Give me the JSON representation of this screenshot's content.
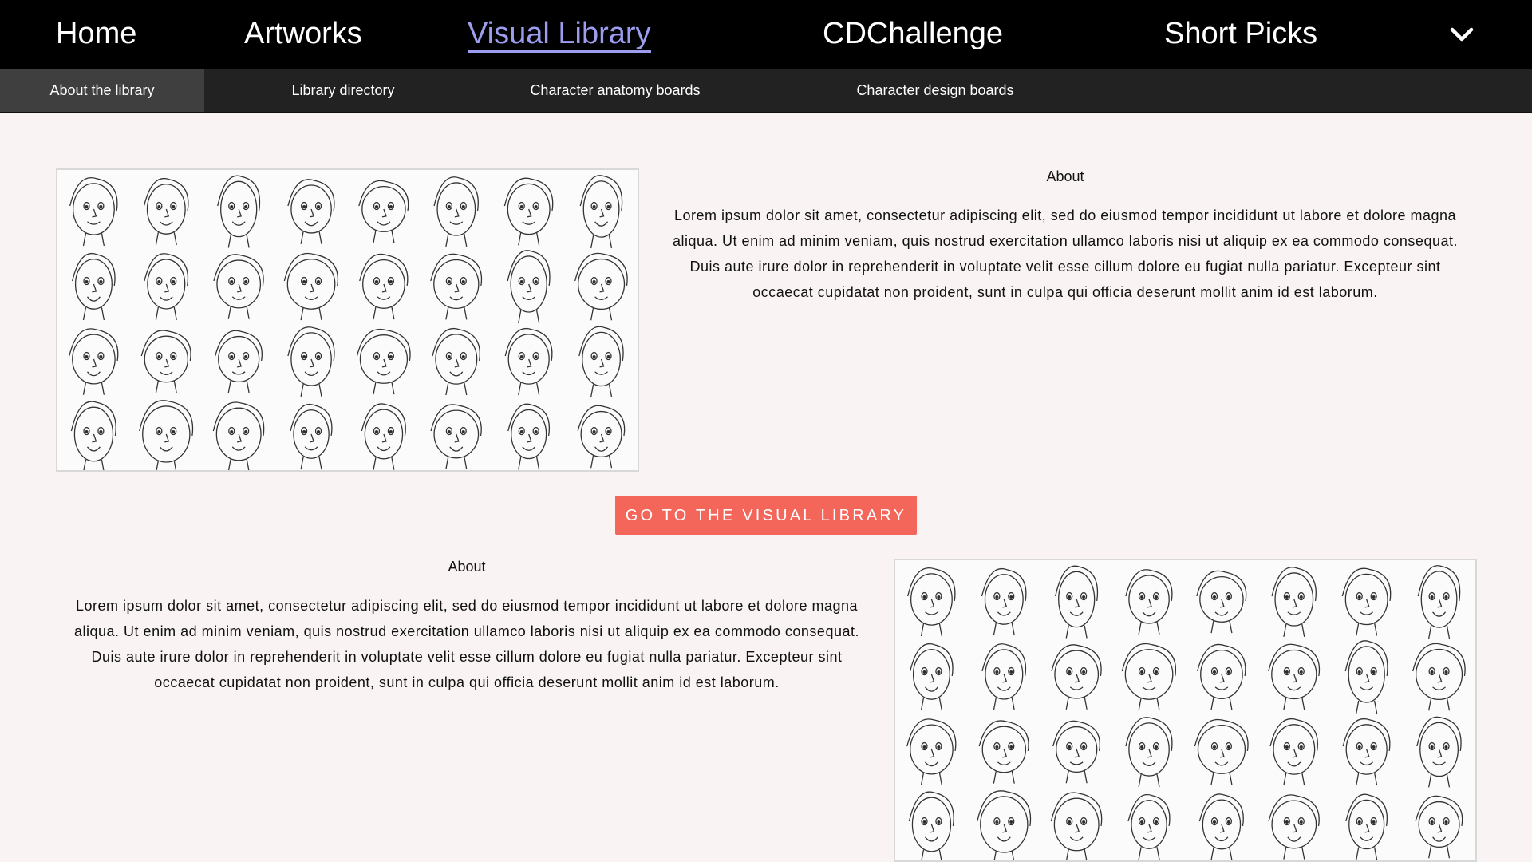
{
  "nav": {
    "items": [
      {
        "label": "Home"
      },
      {
        "label": "Artworks"
      },
      {
        "label": "Visual Library",
        "active": true
      },
      {
        "label": "CDChallenge"
      },
      {
        "label": "Short Picks"
      }
    ],
    "more_icon": "chevron-down-icon",
    "active_color": "#9d9df0"
  },
  "subnav": {
    "items": [
      {
        "label": "About the library",
        "active": true
      },
      {
        "label": "Library directory"
      },
      {
        "label": "Character anatomy boards"
      },
      {
        "label": "Character design boards"
      }
    ]
  },
  "section1": {
    "title": "About",
    "body": "Lorem ipsum dolor sit amet, consectetur adipiscing elit, sed do eiusmod tempor incididunt ut labore et dolore magna aliqua. Ut enim ad minim veniam, quis nostrud exercitation ullamco laboris nisi ut aliquip ex ea commodo consequat. Duis aute irure dolor in reprehenderit in voluptate velit esse cillum dolore eu fugiat nulla pariatur. Excepteur sint occaecat cupidatat non proident, sunt in culpa qui officia deserunt mollit anim id est laborum."
  },
  "cta": {
    "label": "GO TO THE VISUAL LIBRARY",
    "color": "#f4655a"
  },
  "section2": {
    "title": "About",
    "body": "Lorem ipsum dolor sit amet, consectetur adipiscing elit, sed do eiusmod tempor incididunt ut labore et dolore magna aliqua. Ut enim ad minim veniam, quis nostrud exercitation ullamco laboris nisi ut aliquip ex ea commodo consequat. Duis aute irure dolor in reprehenderit in voluptate velit esse cillum dolore eu fugiat nulla pariatur. Excepteur sint occaecat cupidatat non proident, sunt in culpa qui officia deserunt mollit anim id est laborum."
  },
  "images": {
    "description_icon": "character-sketch-grid-image"
  }
}
